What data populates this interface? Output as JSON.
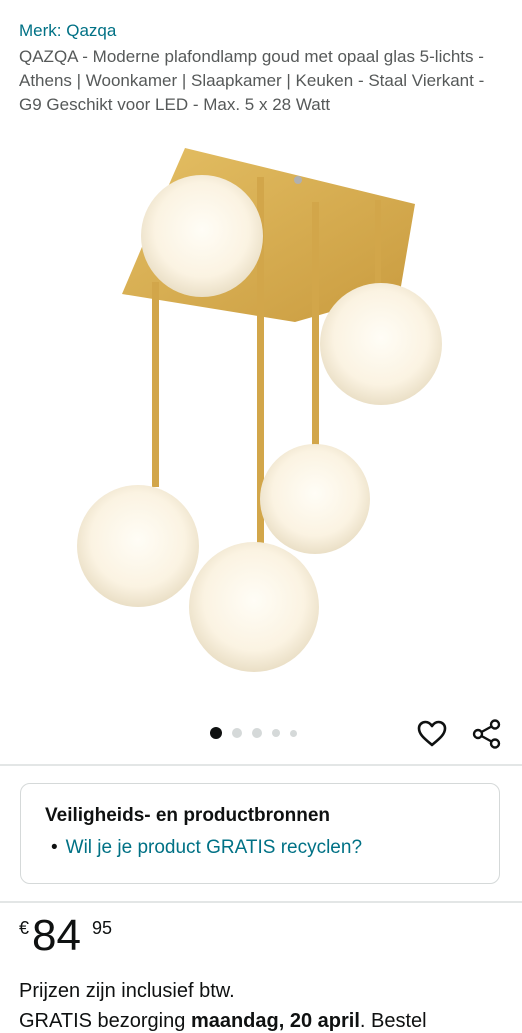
{
  "product": {
    "brand_label": "Merk: Qazqa",
    "title": "QAZQA - Moderne plafondlamp goud met opaal glas 5-lichts - Athens | Woonkamer | Slaapkamer | Keuken - Staal Vierkant - G9 Geschikt voor LED - Max. 5 x 28 Watt"
  },
  "gallery": {
    "image_count": 5,
    "active_index": 0,
    "heart_icon": "heart-icon",
    "share_icon": "share-icon"
  },
  "safety": {
    "heading": "Veiligheids- en productbronnen",
    "link": "Wil je je product GRATIS recyclen?"
  },
  "price": {
    "symbol": "€",
    "whole": "84",
    "fraction": "95",
    "vat_note": "Prijzen zijn inclusief btw."
  },
  "delivery": {
    "prefix": "GRATIS bezorging ",
    "date": "maandag, 20 april",
    "suffix": ". Bestel"
  },
  "colors": {
    "link": "#007185",
    "brass": "#d6ae55",
    "glass": "#fbf6ea"
  }
}
